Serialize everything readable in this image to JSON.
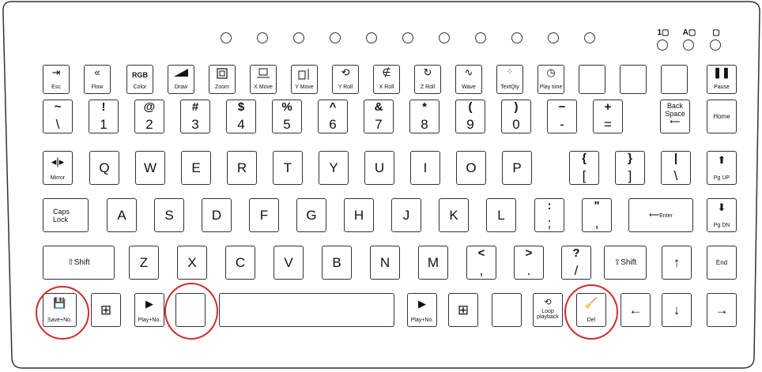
{
  "indicator_labels": {
    "caps": "A",
    "num": "1"
  },
  "keys": {
    "esc": "Esc",
    "flow": "Flow",
    "color": "Color",
    "rgb": "RGB",
    "draw": "Draw",
    "zoom": "Zoom",
    "xmove": "X Move",
    "ymove": "Y Move",
    "yroll": "Y Roll",
    "xroll": "X Roll",
    "zroll": "Z Roll",
    "wave": "Wave",
    "textqty": "TextQty",
    "playtime": "Play time",
    "pause": "Pause",
    "backspace1": "Back",
    "backspace2": "Space",
    "home": "Home",
    "mirror": "Mirror",
    "pgup": "Pg UP",
    "caps1": "Caps",
    "caps2": "Lock",
    "enter": "Enter",
    "pgdn": "Pg DN",
    "shift_l": "Shift",
    "shift_r": "Shift",
    "end": "End",
    "save": "Save+No.",
    "play_l": "Play+No.",
    "play_r": "Play+No.",
    "loop1": "Loop",
    "loop2": "playback",
    "del": "Del"
  },
  "number_row": [
    {
      "top": "~",
      "bot": "\\"
    },
    {
      "top": "!",
      "bot": "1"
    },
    {
      "top": "@",
      "bot": "2"
    },
    {
      "top": "#",
      "bot": "3"
    },
    {
      "top": "$",
      "bot": "4"
    },
    {
      "top": "%",
      "bot": "5"
    },
    {
      "top": "^",
      "bot": "6"
    },
    {
      "top": "&",
      "bot": "7"
    },
    {
      "top": "*",
      "bot": "8"
    },
    {
      "top": "(",
      "bot": "9"
    },
    {
      "top": ")",
      "bot": "0"
    },
    {
      "top": "−",
      "bot": "-"
    },
    {
      "top": "+",
      "bot": "="
    }
  ],
  "row_q": [
    "Q",
    "W",
    "E",
    "R",
    "T",
    "Y",
    "U",
    "I",
    "O",
    "P"
  ],
  "row_q_sym": [
    {
      "top": "{",
      "bot": "["
    },
    {
      "top": "}",
      "bot": "]"
    },
    {
      "top": "|",
      "bot": "\\"
    }
  ],
  "row_a": [
    "A",
    "S",
    "D",
    "F",
    "G",
    "H",
    "J",
    "K",
    "L"
  ],
  "row_a_sym": [
    {
      "top": ":",
      "bot": ";"
    },
    {
      "top": "\"",
      "bot": ","
    }
  ],
  "row_z": [
    "Z",
    "X",
    "C",
    "V",
    "B",
    "N",
    "M"
  ],
  "row_z_sym": [
    {
      "top": "<",
      "bot": ","
    },
    {
      "top": ">",
      "bot": "."
    },
    {
      "top": "?",
      "bot": "/"
    }
  ]
}
